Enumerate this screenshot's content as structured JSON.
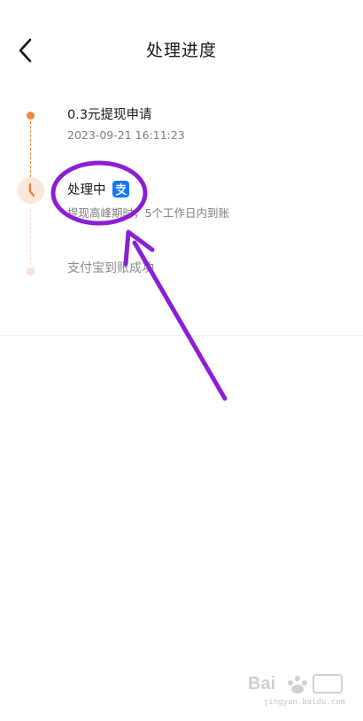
{
  "header": {
    "title": "处理进度",
    "back_icon": "chevron-left-icon"
  },
  "timeline": {
    "steps": [
      {
        "status": "done",
        "title": "0.3元提现申请",
        "subtitle": "2023-09-21 16:11:23"
      },
      {
        "status": "current",
        "title": "处理中",
        "subtitle": "提现高峰期时，5个工作日内到账",
        "badge_icon": "alipay-icon"
      },
      {
        "status": "pending",
        "title": "支付宝到账成功"
      }
    ]
  },
  "colors": {
    "accent": "#ee8a3c",
    "accent_light": "#fbe6db",
    "alipay_blue": "#1677ff",
    "annotation_purple": "#8a1fd6"
  },
  "watermark": {
    "logo": "baidu-jingyan-logo",
    "text": "jingyan.baidu.com"
  }
}
